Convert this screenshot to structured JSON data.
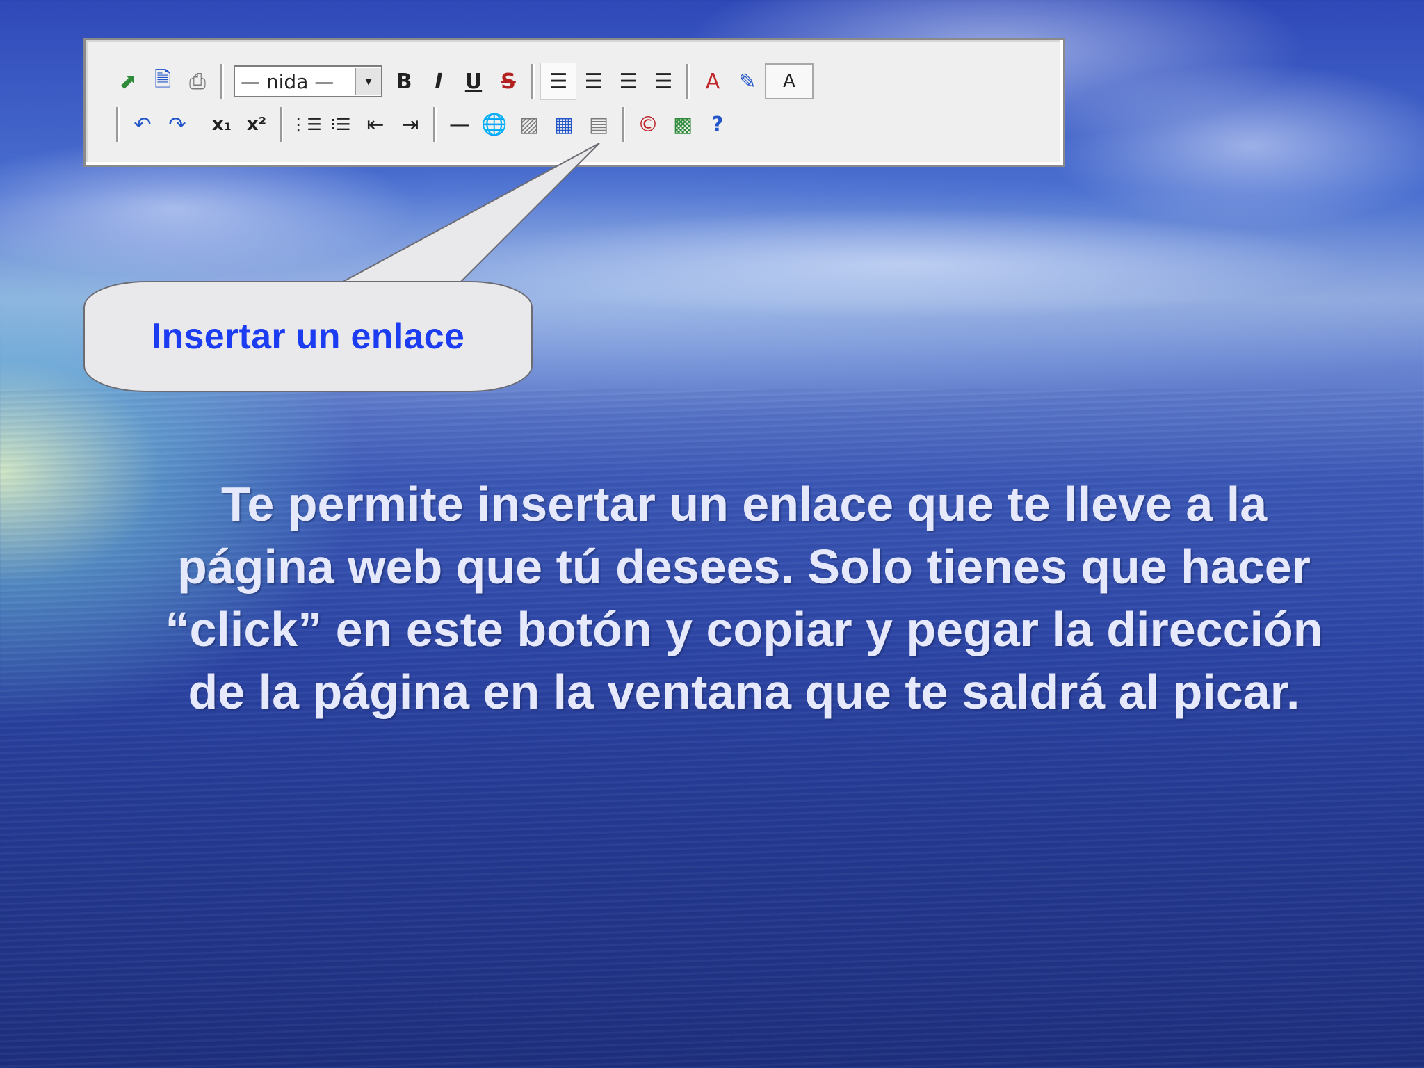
{
  "toolbar": {
    "font_select": {
      "value": "— nida —",
      "arrow": "▾"
    },
    "row1": [
      {
        "name": "insert-image-icon",
        "glyph": "⬈"
      },
      {
        "name": "view-source-icon",
        "glyph": "🗎"
      },
      {
        "name": "print-icon",
        "glyph": "⎙"
      },
      {
        "name": "bold-button",
        "glyph": "B"
      },
      {
        "name": "italic-button",
        "glyph": "I"
      },
      {
        "name": "underline-button",
        "glyph": "U"
      },
      {
        "name": "strikethrough-button",
        "glyph": "S"
      },
      {
        "name": "align-left-icon",
        "glyph": "☰"
      },
      {
        "name": "align-center-icon",
        "glyph": "☰"
      },
      {
        "name": "align-right-icon",
        "glyph": "☰"
      },
      {
        "name": "align-justify-icon",
        "glyph": "☰"
      },
      {
        "name": "text-color-icon",
        "glyph": "A"
      },
      {
        "name": "highlight-color-icon",
        "glyph": "✎"
      },
      {
        "name": "remove-format-icon",
        "glyph": "A"
      }
    ],
    "row2": [
      {
        "name": "undo-icon",
        "glyph": "↶"
      },
      {
        "name": "redo-icon",
        "glyph": "↷"
      },
      {
        "name": "subscript-icon",
        "glyph": "x₁"
      },
      {
        "name": "superscript-icon",
        "glyph": "x²"
      },
      {
        "name": "ordered-list-icon",
        "glyph": "⋮☰"
      },
      {
        "name": "unordered-list-icon",
        "glyph": "⁝☰"
      },
      {
        "name": "outdent-icon",
        "glyph": "⇤"
      },
      {
        "name": "indent-icon",
        "glyph": "⇥"
      },
      {
        "name": "horizontal-rule-icon",
        "glyph": "—"
      },
      {
        "name": "insert-link-icon",
        "glyph": "🌐"
      },
      {
        "name": "insert-picture-icon",
        "glyph": "▨"
      },
      {
        "name": "insert-table-icon",
        "glyph": "▦"
      },
      {
        "name": "table-properties-icon",
        "glyph": "▤"
      },
      {
        "name": "special-characters-icon",
        "glyph": "©"
      },
      {
        "name": "show-blocks-icon",
        "glyph": "▩"
      },
      {
        "name": "help-icon",
        "glyph": "?"
      }
    ]
  },
  "callout": {
    "label": "Insertar un enlace"
  },
  "body": {
    "text": "Te permite insertar un enlace que te lleve a la página web que tú desees. Solo tienes que hacer “click” en este botón y copiar y pegar la dirección de la página en la ventana que te saldrá al picar."
  },
  "colors": {
    "callout_text": "#1b3cf0",
    "body_text": "#e6e9fb",
    "sea_dark": "#1e2f7e"
  }
}
